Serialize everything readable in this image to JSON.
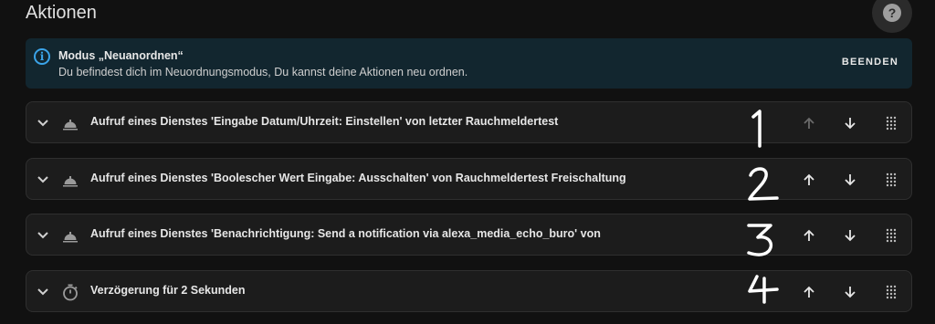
{
  "header": {
    "title": "Aktionen",
    "help_icon": "help-circle-icon"
  },
  "info": {
    "icon": "info-icon",
    "title": "Modus „Neuanordnen“",
    "description": "Du befindest dich im Neuordnungsmodus, Du kannst deine Aktionen neu ordnen.",
    "action_label": "BEENDEN"
  },
  "actions": [
    {
      "icon": "service-bell-icon",
      "label": "Aufruf eines Dienstes 'Eingabe Datum/Uhrzeit: Einstellen' von letzter Rauchmeldertest",
      "up_disabled": true,
      "annotation": "1"
    },
    {
      "icon": "service-bell-icon",
      "label": "Aufruf eines Dienstes 'Boolescher Wert Eingabe: Ausschalten' von Rauchmeldertest Freischaltung",
      "up_disabled": false,
      "annotation": "2"
    },
    {
      "icon": "service-bell-icon",
      "label": "Aufruf eines Dienstes 'Benachrichtigung: Send a notification via alexa_media_echo_buro' von",
      "up_disabled": false,
      "annotation": "3"
    },
    {
      "icon": "timer-icon",
      "label": "Verzögerung für 2 Sekunden",
      "up_disabled": false,
      "annotation": "4"
    }
  ],
  "colors": {
    "background": "#111111",
    "card": "#1c1c1c",
    "accent": "#3ba4e9",
    "info_bg": "#12262f"
  }
}
